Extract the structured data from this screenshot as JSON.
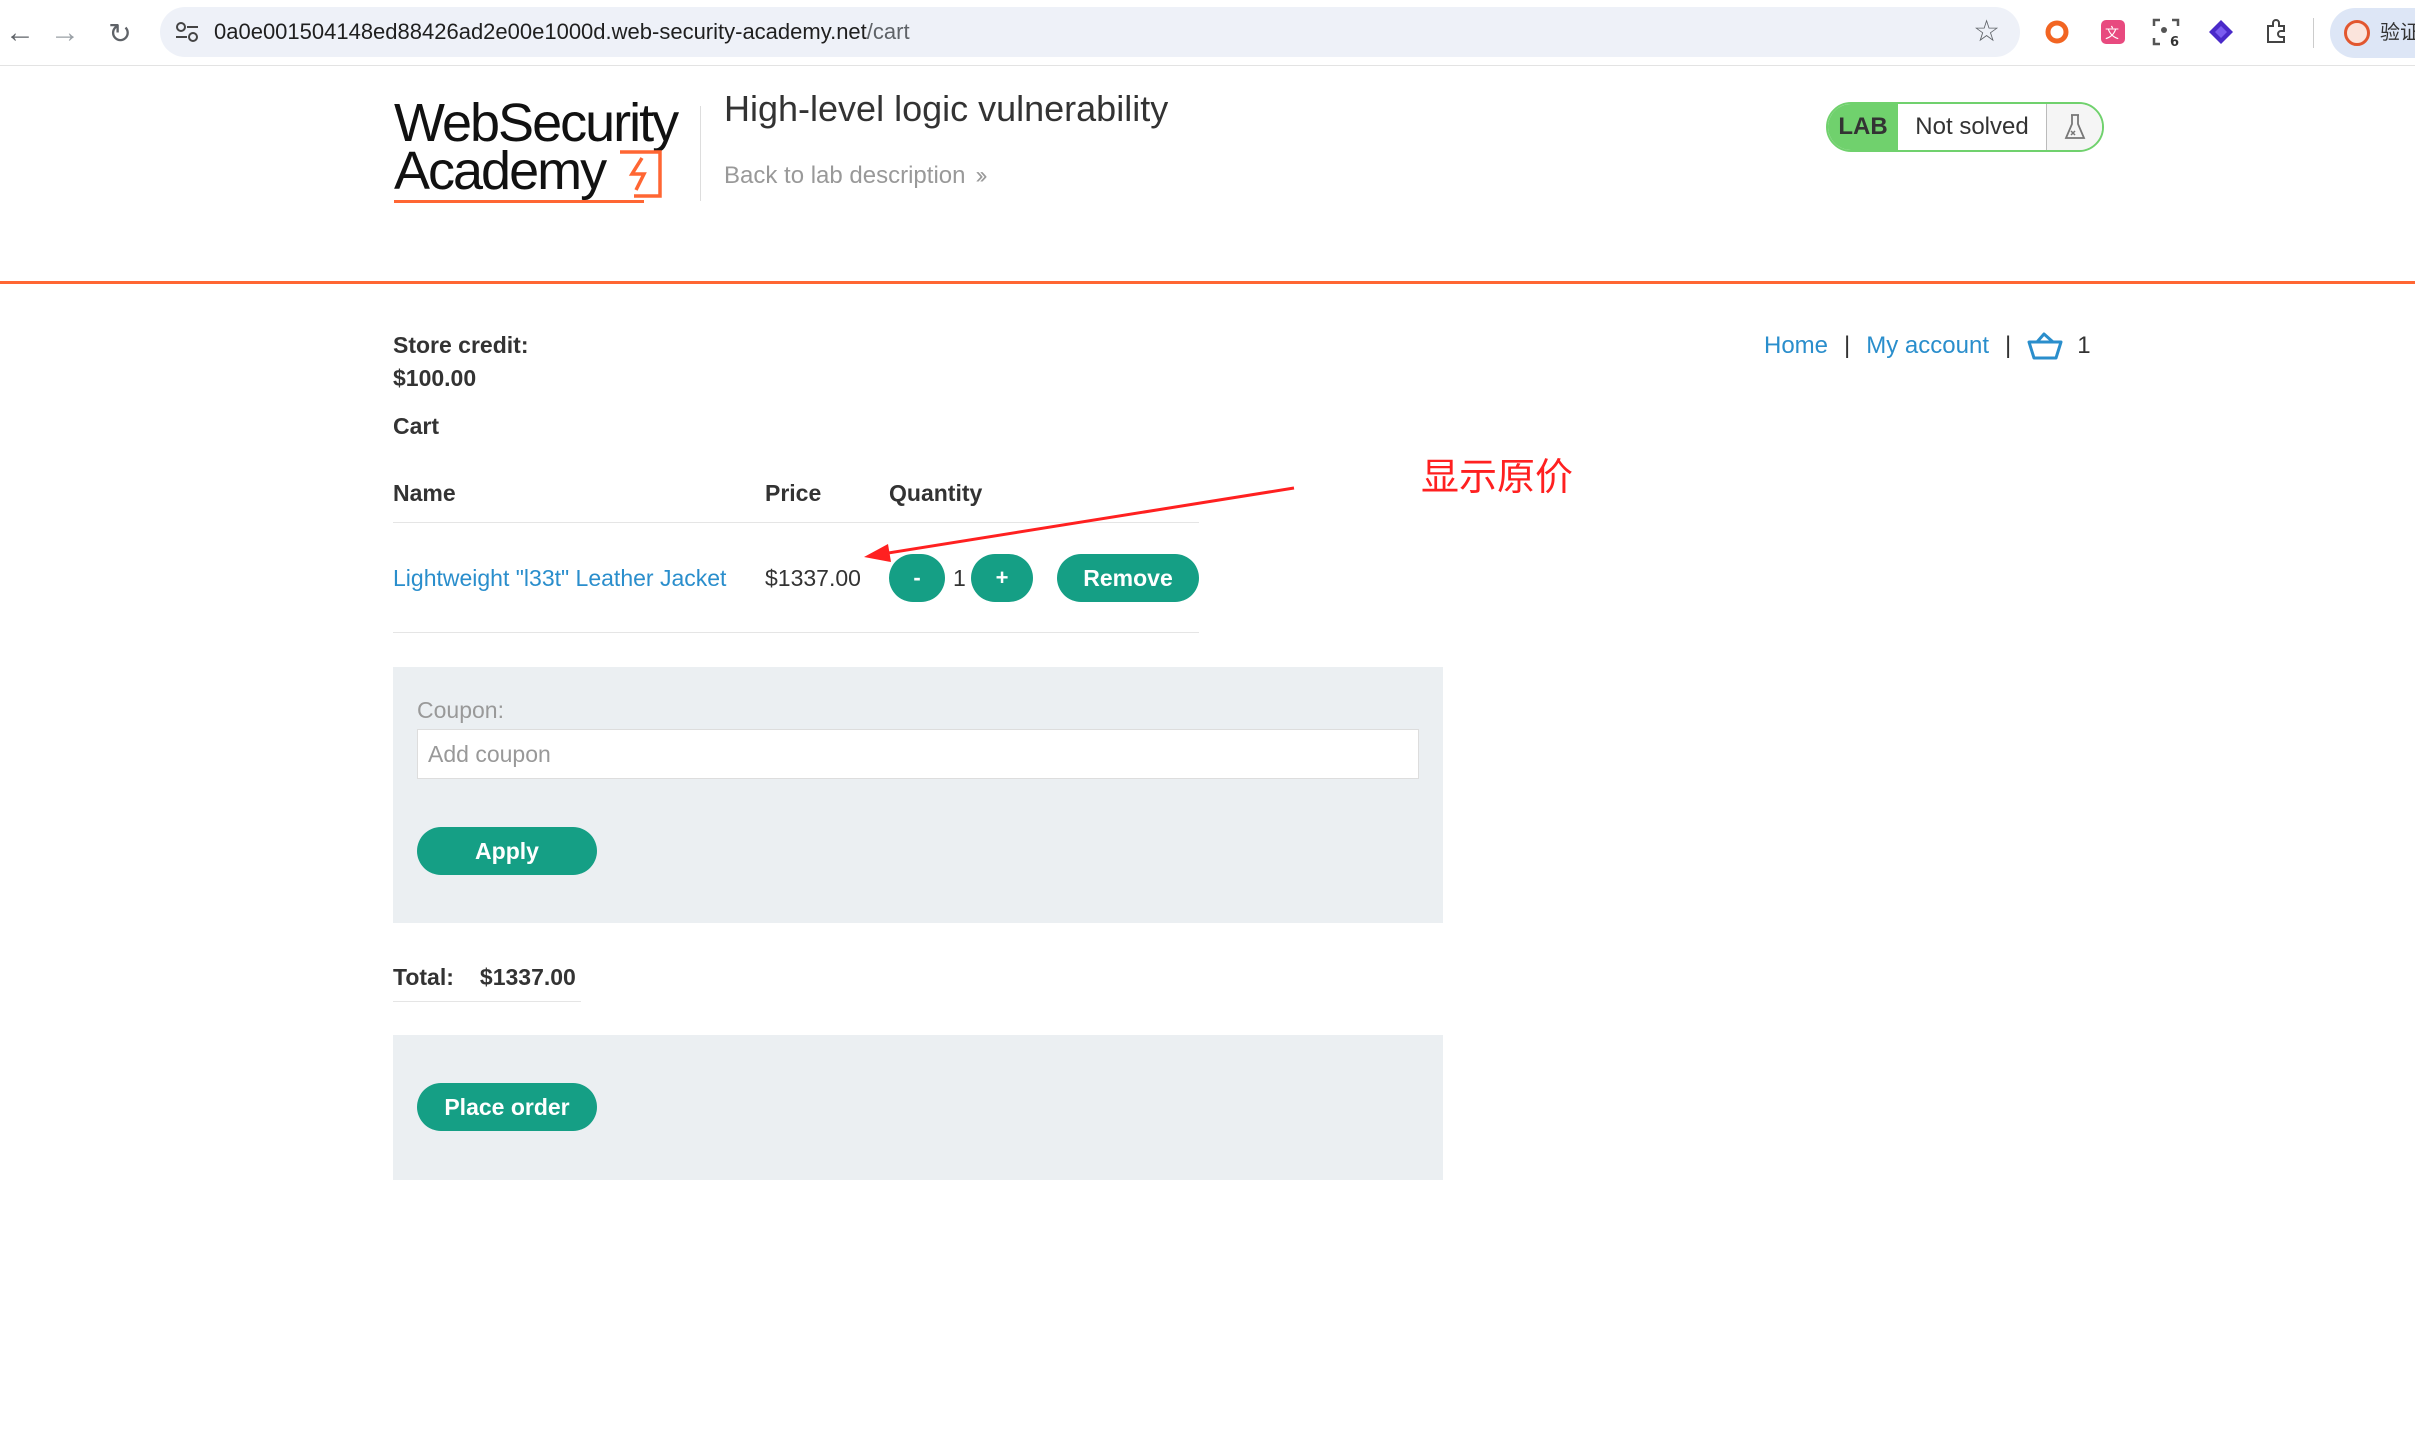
{
  "browser": {
    "url_host": "0a0e001504148ed88426ad2e00e1000d.web-security-academy.net",
    "url_path": "/cart",
    "profile_label": "验证",
    "ext_badge": "6"
  },
  "header": {
    "logo_line1": "WebSecurity",
    "logo_line2": "Academy",
    "lab_title": "High-level logic vulnerability",
    "back_link": "Back to lab description",
    "lab_tag": "LAB",
    "lab_state": "Not solved"
  },
  "nav": {
    "home": "Home",
    "separator": "|",
    "my_account": "My account",
    "cart_count": "1"
  },
  "store": {
    "credit_label": "Store credit:",
    "credit_value": "$100.00",
    "cart_heading": "Cart"
  },
  "cart": {
    "headers": {
      "name": "Name",
      "price": "Price",
      "quantity": "Quantity"
    },
    "items": [
      {
        "name": "Lightweight \"l33t\" Leather Jacket",
        "price": "$1337.00",
        "quantity": "1",
        "minus_label": "-",
        "plus_label": "+",
        "remove_label": "Remove"
      }
    ]
  },
  "coupon": {
    "label": "Coupon:",
    "placeholder": "Add coupon",
    "value": "",
    "apply_label": "Apply"
  },
  "total": {
    "label": "Total:",
    "value": "$1337.00"
  },
  "order": {
    "place_order_label": "Place order"
  },
  "annotation": {
    "text": "显示原价",
    "color": "#ff2020"
  },
  "colors": {
    "accent_orange": "#ff6633",
    "button_teal": "#159f85",
    "link_blue": "#2a8ecc",
    "lab_green": "#70d16d",
    "panel_grey": "#ebeff2"
  }
}
